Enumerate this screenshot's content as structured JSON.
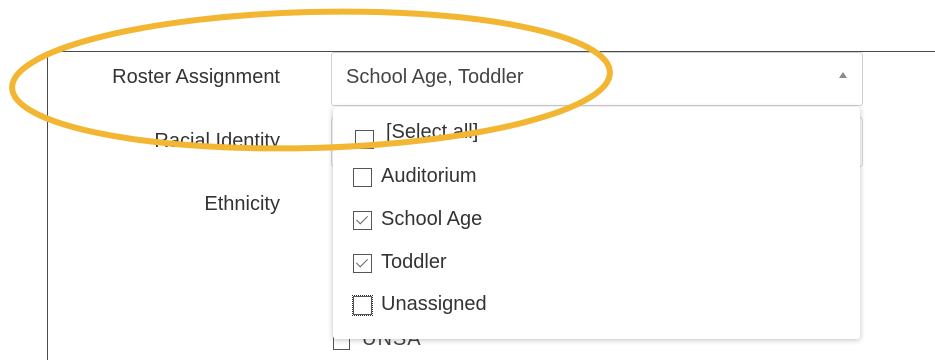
{
  "form": {
    "fields": {
      "roster_label": "Roster Assignment",
      "racial_label": "Racial Identity",
      "ethnicity_label": "Ethnicity"
    },
    "roster_select": {
      "value": "School Age, Toddler",
      "options": [
        {
          "label": "[Select all]",
          "checked": false
        },
        {
          "label": "Auditorium",
          "checked": false
        },
        {
          "label": "School Age",
          "checked": true
        },
        {
          "label": "Toddler",
          "checked": true
        },
        {
          "label": "Unassigned",
          "checked": false
        }
      ]
    },
    "peek_option": "UNSA"
  },
  "icons": {
    "caret": "caret-up-icon",
    "checkbox": "checkbox-icon"
  },
  "colors": {
    "annotation": "#F2B632",
    "border": "#d0d0d0",
    "text": "#333333"
  }
}
